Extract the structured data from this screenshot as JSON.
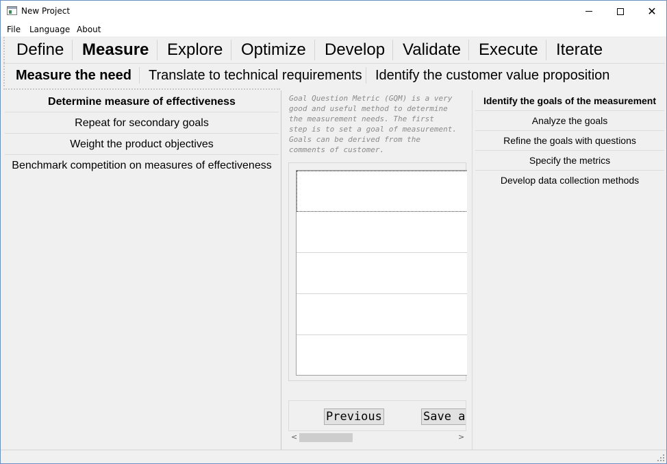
{
  "window": {
    "title": "New Project",
    "icons": {
      "app": "app-window-icon",
      "minimize": "minimize-icon",
      "maximize": "maximize-icon",
      "close": "close-icon"
    },
    "close_glyph": "✕"
  },
  "menu": {
    "items": [
      "File",
      "Language",
      "About"
    ]
  },
  "main_tabs": {
    "items": [
      "Define",
      "Measure",
      "Explore",
      "Optimize",
      "Develop",
      "Validate",
      "Execute",
      "Iterate"
    ],
    "selected": "Measure"
  },
  "sub_tabs": {
    "items": [
      "Measure the need",
      "Translate to technical requirements",
      "Identify the customer value proposition"
    ],
    "selected": "Measure the need"
  },
  "left_list": {
    "items": [
      "Determine measure of effectiveness",
      "Repeat for secondary goals",
      "Weight the product objectives",
      "Benchmark competition on measures of effectiveness"
    ],
    "selected": "Determine measure of effectiveness"
  },
  "center": {
    "description_lines": [
      "Goal Question Metric (GQM) is a very",
      "good and useful method to determine",
      "the measurement needs. The first",
      "step is to set a goal of measurement.",
      "Goals can be derived from the",
      "comments of customer."
    ],
    "grid_rows": [
      "",
      "",
      "",
      "",
      ""
    ],
    "buttons": {
      "previous": "Previous",
      "save": "Save a"
    },
    "scroll": {
      "left_arrow": "<",
      "right_arrow": ">"
    }
  },
  "right_list": {
    "items": [
      "Identify the goals of the measurement",
      "Analyze the goals",
      "Refine the goals with questions",
      "Specify the metrics",
      "Develop data collection methods"
    ],
    "selected": "Identify the goals of the measurement"
  }
}
